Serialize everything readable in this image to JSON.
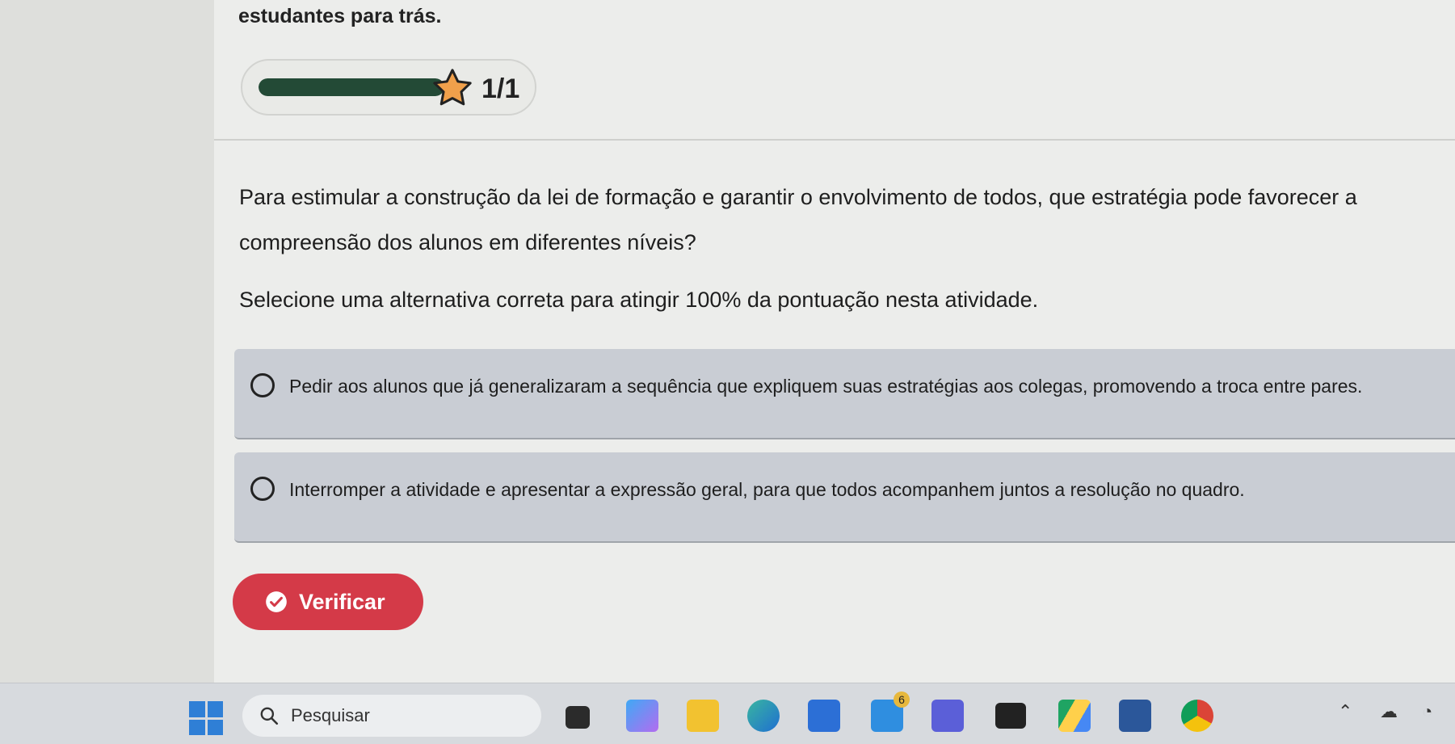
{
  "heading": "estudantes para trás.",
  "progress": {
    "count_label": "1/1",
    "fraction": 1.0,
    "star_color": "#f0a04b"
  },
  "question": {
    "text": "Para estimular a construção da lei de formação e garantir o envolvimento de todos, que estratégia pode favorecer a compreensão dos alunos em diferentes níveis?",
    "instruction": "Selecione uma alternativa correta para atingir 100% da pontuação nesta atividade."
  },
  "options": [
    {
      "label": "Pedir aos alunos que já generalizaram a sequência que expliquem suas estratégias aos colegas, promovendo a troca entre pares.",
      "selected": false
    },
    {
      "label": "Interromper a atividade e apresentar a expressão geral, para que todos acompanhem juntos a resolução no quadro.",
      "selected": false
    }
  ],
  "verify_button": {
    "label": "Verificar",
    "color": "#d43a48"
  },
  "taskbar": {
    "search_placeholder": "Pesquisar",
    "apps": [
      "file-explorer-icon",
      "copilot-icon",
      "folder-icon",
      "edge-icon",
      "store-icon",
      "notification-app-icon",
      "bookmark-app-icon",
      "dropbox-icon",
      "google-drive-icon",
      "word-icon",
      "chrome-icon"
    ],
    "notification_badge": "6"
  }
}
